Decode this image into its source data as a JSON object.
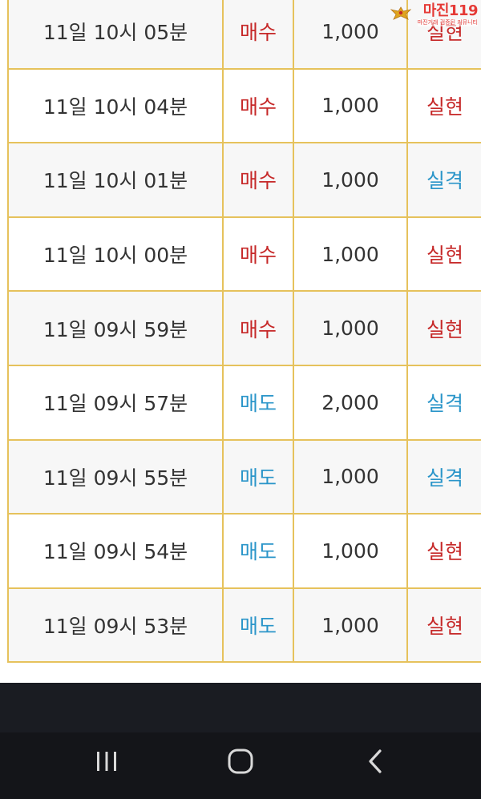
{
  "watermark": {
    "title": "마진119",
    "subtitle": "마진거래 검증된 커뮤니티"
  },
  "table": {
    "columns": [
      "time",
      "type",
      "amount",
      "result"
    ],
    "rows": [
      {
        "time": "11일 10시 05분",
        "type": "매수",
        "type_color": "red",
        "amount": "1,000",
        "result": "실현",
        "result_color": "red"
      },
      {
        "time": "11일 10시 04분",
        "type": "매수",
        "type_color": "red",
        "amount": "1,000",
        "result": "실현",
        "result_color": "red"
      },
      {
        "time": "11일 10시 01분",
        "type": "매수",
        "type_color": "red",
        "amount": "1,000",
        "result": "실격",
        "result_color": "blue"
      },
      {
        "time": "11일 10시 00분",
        "type": "매수",
        "type_color": "red",
        "amount": "1,000",
        "result": "실현",
        "result_color": "red"
      },
      {
        "time": "11일 09시 59분",
        "type": "매수",
        "type_color": "red",
        "amount": "1,000",
        "result": "실현",
        "result_color": "red"
      },
      {
        "time": "11일 09시 57분",
        "type": "매도",
        "type_color": "blue",
        "amount": "2,000",
        "result": "실격",
        "result_color": "blue"
      },
      {
        "time": "11일 09시 55분",
        "type": "매도",
        "type_color": "blue",
        "amount": "1,000",
        "result": "실격",
        "result_color": "blue"
      },
      {
        "time": "11일 09시 54분",
        "type": "매도",
        "type_color": "blue",
        "amount": "1,000",
        "result": "실현",
        "result_color": "red"
      },
      {
        "time": "11일 09시 53분",
        "type": "매도",
        "type_color": "blue",
        "amount": "1,000",
        "result": "실현",
        "result_color": "red"
      }
    ]
  },
  "colors": {
    "red": "#c62828",
    "blue": "#2a95c9",
    "border": "#e6c25c",
    "nav_background": "#141519"
  },
  "nav_bar": {
    "buttons": [
      {
        "name": "recent-apps",
        "icon": "three-bars-icon"
      },
      {
        "name": "home",
        "icon": "rounded-square-icon"
      },
      {
        "name": "back",
        "icon": "chevron-left-icon"
      }
    ]
  }
}
